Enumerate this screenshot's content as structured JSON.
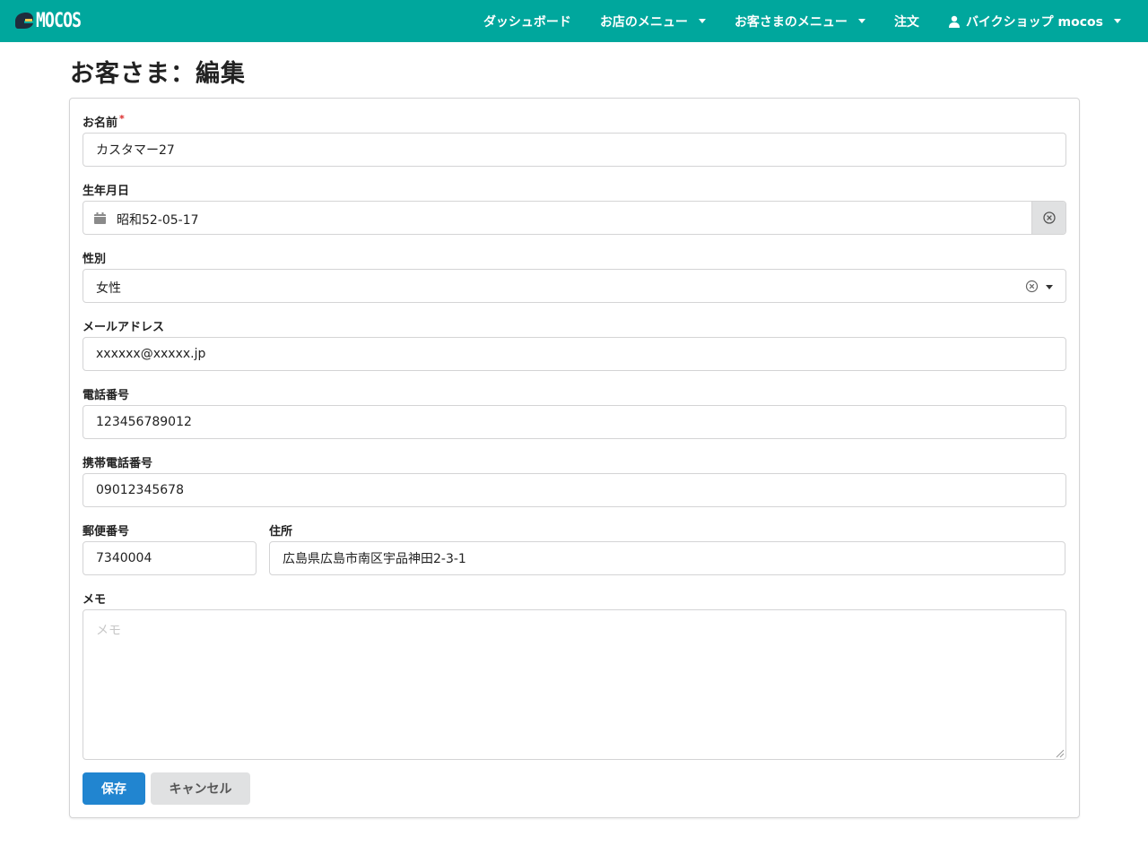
{
  "navbar": {
    "brand": "MOCOS",
    "items": [
      {
        "label": "ダッシュボード"
      },
      {
        "label": "お店のメニュー"
      },
      {
        "label": "お客さまのメニュー"
      },
      {
        "label": "注文"
      },
      {
        "label": "バイクショップ mocos"
      }
    ],
    "background": "#00a79d"
  },
  "page": {
    "title": "お客さま：編集"
  },
  "form": {
    "name": {
      "label": "お名前",
      "required_mark": "*",
      "value": "カスタマー27"
    },
    "birthday": {
      "label": "生年月日",
      "value": "昭和52-05-17"
    },
    "gender": {
      "label": "性別",
      "value": "女性"
    },
    "email": {
      "label": "メールアドレス",
      "value": "xxxxxx@xxxxx.jp"
    },
    "phone": {
      "label": "電話番号",
      "value": "123456789012"
    },
    "mobile": {
      "label": "携帯電話番号",
      "value": "09012345678"
    },
    "postal": {
      "label": "郵便番号",
      "value": "7340004"
    },
    "address": {
      "label": "住所",
      "value": "広島県広島市南区宇品神田2-3-1"
    },
    "memo": {
      "label": "メモ",
      "placeholder": "メモ",
      "value": ""
    }
  },
  "buttons": {
    "save": "保存",
    "cancel": "キャンセル"
  },
  "colors": {
    "primary": "#2185d0",
    "accent": "#00a79d",
    "required": "#db2828"
  }
}
